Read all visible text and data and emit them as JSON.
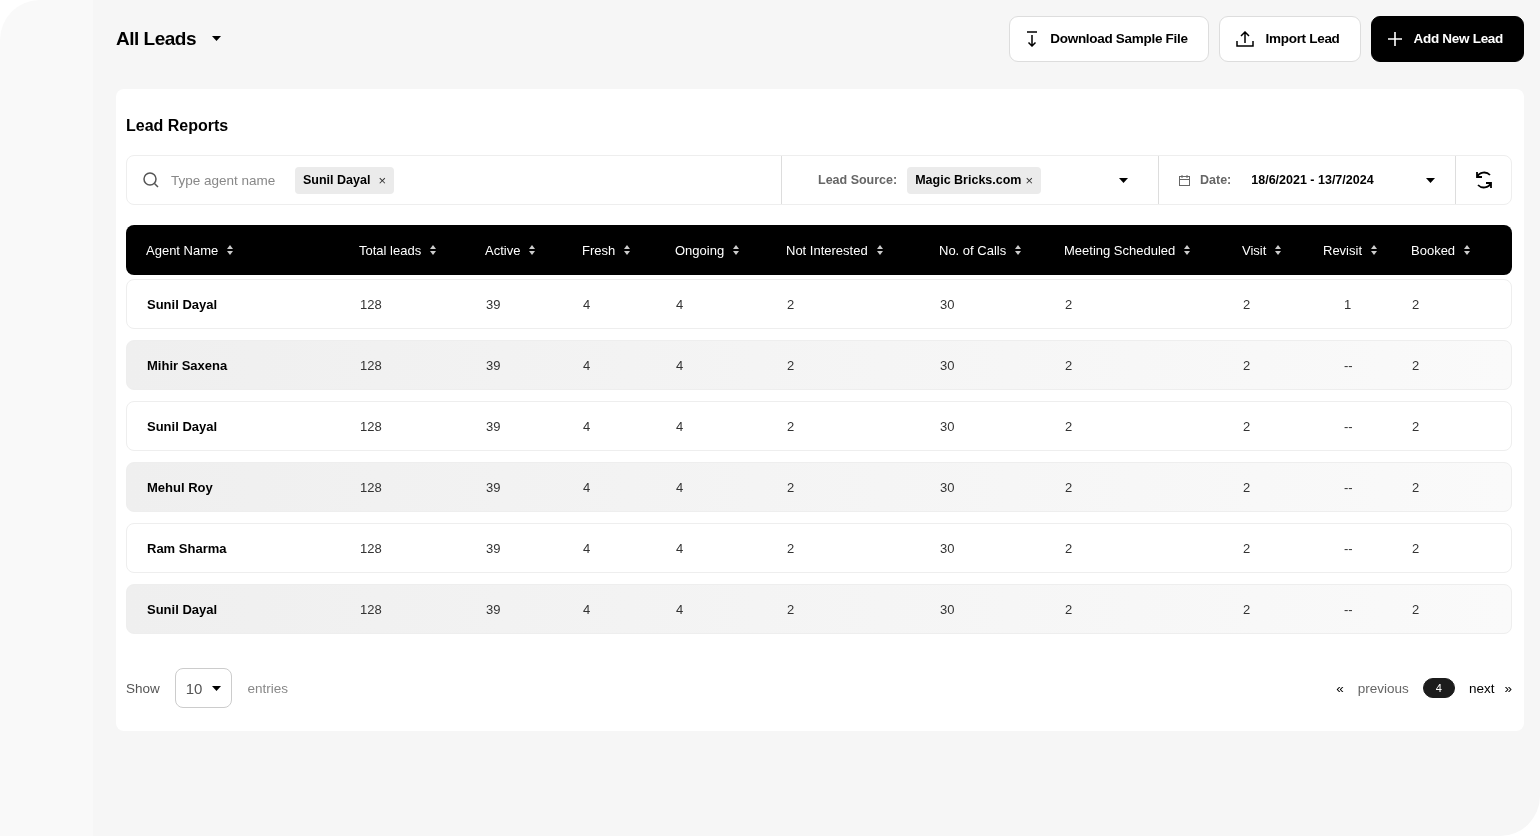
{
  "header": {
    "title": "All Leads",
    "buttons": [
      {
        "kind": "download",
        "label": "Download Sample File"
      },
      {
        "kind": "import",
        "label": "Import Lead"
      },
      {
        "kind": "add",
        "label": "Add New Lead"
      }
    ]
  },
  "report": {
    "title": "Lead Reports",
    "filters": {
      "agent_placeholder": "Type agent name",
      "agent_chip": "Sunil Dayal",
      "chip_close": "×",
      "source_label": "Lead Source:",
      "source_chip": "Magic Bricks.com",
      "source_close": "×",
      "date_label": "Date:",
      "date_value": "18/6/2021 - 13/7/2024"
    },
    "table": {
      "columns": [
        "Agent Name",
        "Total leads",
        "Active",
        "Fresh",
        "Ongoing",
        "Not Interested",
        "No. of Calls",
        "Meeting Scheduled",
        "Visit",
        "Revisit",
        "Booked"
      ],
      "rows": [
        [
          "Sunil Dayal",
          "128",
          "39",
          "4",
          "4",
          "2",
          "30",
          "2",
          "2",
          "1",
          "2"
        ],
        [
          "Mihir Saxena",
          "128",
          "39",
          "4",
          "4",
          "2",
          "30",
          "2",
          "2",
          "--",
          "2"
        ],
        [
          "Sunil Dayal",
          "128",
          "39",
          "4",
          "4",
          "2",
          "30",
          "2",
          "2",
          "--",
          "2"
        ],
        [
          "Mehul Roy",
          "128",
          "39",
          "4",
          "4",
          "2",
          "30",
          "2",
          "2",
          "--",
          "2"
        ],
        [
          "Ram Sharma",
          "128",
          "39",
          "4",
          "4",
          "2",
          "30",
          "2",
          "2",
          "--",
          "2"
        ],
        [
          "Sunil Dayal",
          "128",
          "39",
          "4",
          "4",
          "2",
          "30",
          "2",
          "2",
          "--",
          "2"
        ]
      ]
    },
    "footer": {
      "show_label": "Show",
      "page_size": "10",
      "entries_label": "entries",
      "prev_icon": "«",
      "previous": "previous",
      "pages": [
        {
          "label": "4",
          "selected": true
        }
      ],
      "next": "next",
      "next_icon": "»"
    }
  }
}
